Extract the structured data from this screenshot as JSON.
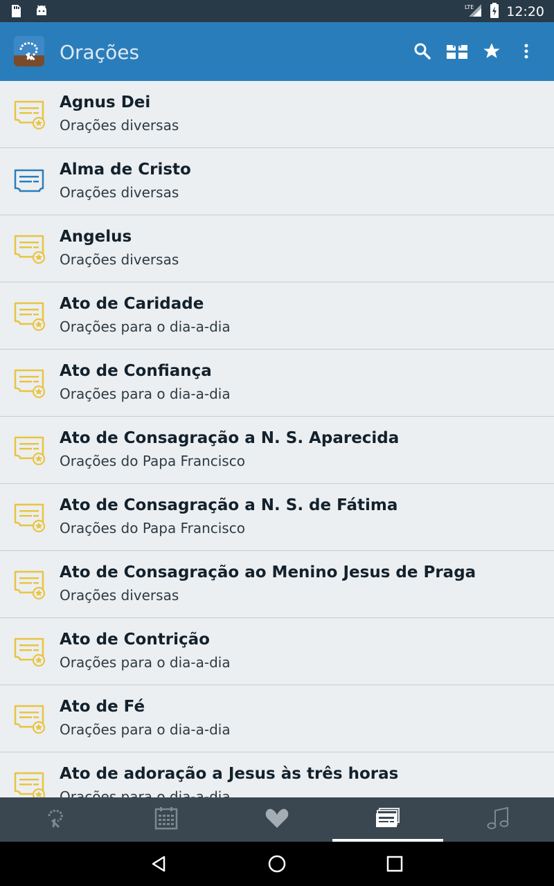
{
  "statusbar": {
    "time": "12:20",
    "network": "LTE"
  },
  "appbar": {
    "title": "Orações",
    "actions": [
      "search-icon",
      "gift-icon",
      "star-icon",
      "more-vert-icon"
    ]
  },
  "colors": {
    "appbar": "#2a7dbb",
    "statusbar": "#283948",
    "list_bg": "#eceff1",
    "icon_yellow": "#e8c441",
    "icon_blue": "#2a7dbb",
    "tabbar": "#3a4750"
  },
  "prayers": [
    {
      "title": "Agnus Dei",
      "category": "Orações diversas",
      "icon": "prayer-doc-star-icon"
    },
    {
      "title": "Alma de Cristo",
      "category": "Orações diversas",
      "icon": "prayer-doc-icon"
    },
    {
      "title": "Angelus",
      "category": "Orações diversas",
      "icon": "prayer-doc-star-icon"
    },
    {
      "title": "Ato de Caridade",
      "category": "Orações para o dia-a-dia",
      "icon": "prayer-doc-star-icon"
    },
    {
      "title": "Ato de Confiança",
      "category": "Orações para o dia-a-dia",
      "icon": "prayer-doc-star-icon"
    },
    {
      "title": "Ato de Consagração a N. S. Aparecida",
      "category": "Orações do Papa Francisco",
      "icon": "prayer-doc-star-icon"
    },
    {
      "title": "Ato de Consagração a N. S. de Fátima",
      "category": "Orações do Papa Francisco",
      "icon": "prayer-doc-star-icon"
    },
    {
      "title": "Ato de Consagração ao Menino Jesus de Praga",
      "category": "Orações diversas",
      "icon": "prayer-doc-star-icon"
    },
    {
      "title": "Ato de Contrição",
      "category": "Orações para o dia-a-dia",
      "icon": "prayer-doc-star-icon"
    },
    {
      "title": "Ato de Fé",
      "category": "Orações para o dia-a-dia",
      "icon": "prayer-doc-star-icon"
    },
    {
      "title": "Ato de adoração a Jesus às três horas",
      "category": "Orações para o dia-a-dia",
      "icon": "prayer-doc-star-icon"
    }
  ],
  "bottom_tabs": [
    {
      "icon": "rosary-icon",
      "selected": false
    },
    {
      "icon": "calendar-icon",
      "selected": false
    },
    {
      "icon": "heart-icon",
      "selected": false
    },
    {
      "icon": "prayers-cards-icon",
      "selected": true
    },
    {
      "icon": "music-note-icon",
      "selected": false
    }
  ],
  "navbar": [
    "back-icon",
    "home-icon",
    "recents-icon"
  ]
}
